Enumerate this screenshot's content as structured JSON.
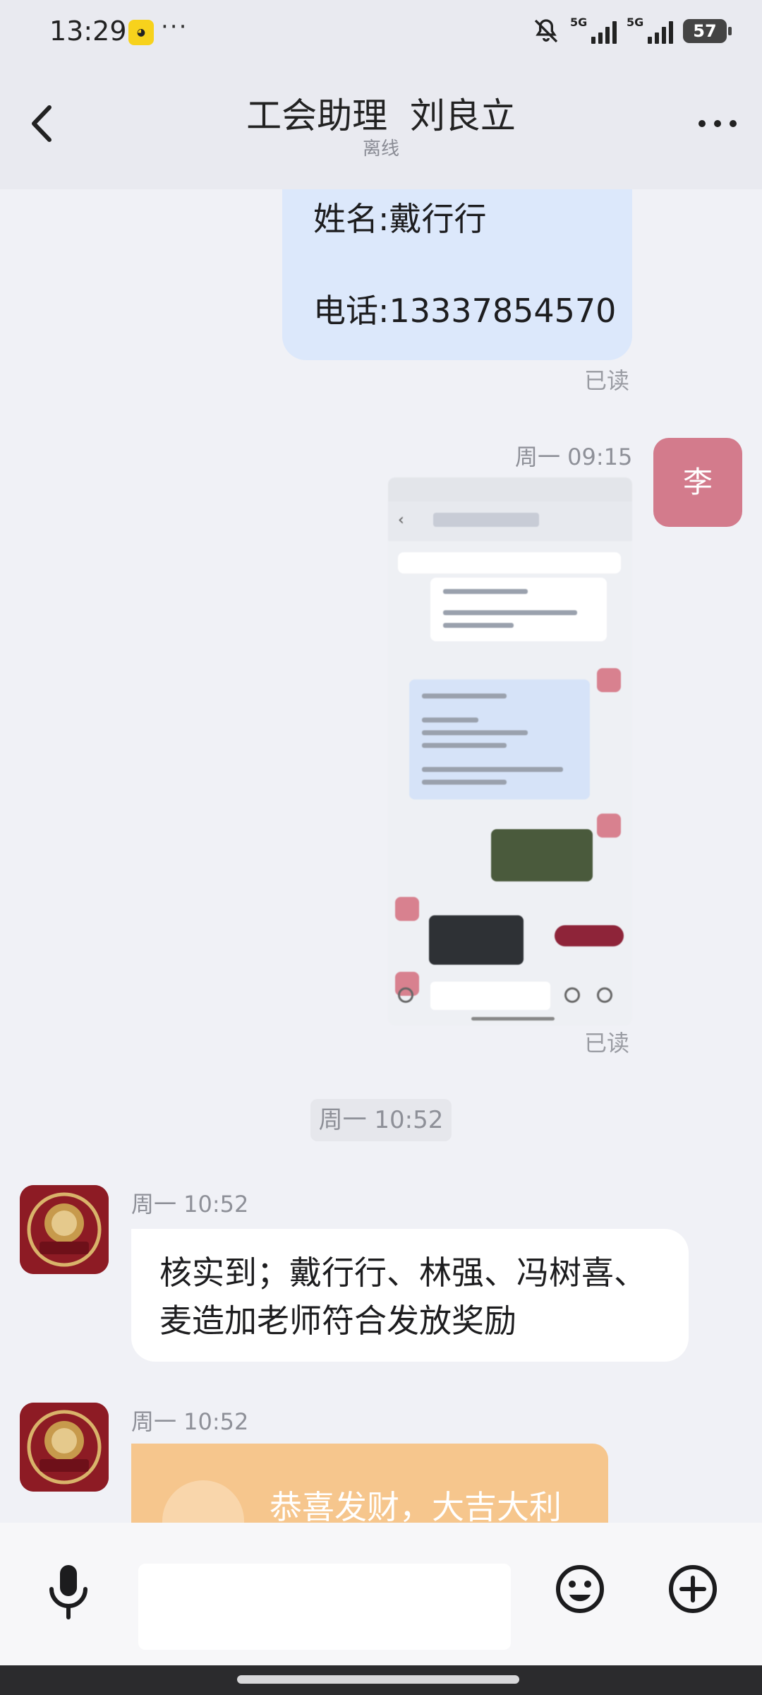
{
  "status_bar": {
    "time": "13:29",
    "dots": "···",
    "signal1_label": "5G",
    "signal2_label": "5G",
    "battery": "57"
  },
  "header": {
    "title": "工会助理  刘良立",
    "subtitle": "离线"
  },
  "messages": {
    "self_card": {
      "name_line": "姓名:戴行行",
      "phone_line": "电话:13337854570",
      "read_status": "已读"
    },
    "self_image": {
      "time": "周一 09:15",
      "avatar_text": "李",
      "read_status": "已读"
    },
    "time_divider": "周一 10:52",
    "other_text": {
      "time": "周一 10:52",
      "avatar_label": "领航工会",
      "text": "核实到；戴行行、林强、冯树喜、麦造加老师符合发放奖励"
    },
    "red_packet": {
      "time": "周一 10:52",
      "avatar_label": "领航工会",
      "text": "恭喜发财，大吉大利"
    }
  },
  "input_bar": {
    "placeholder": ""
  },
  "icons": {
    "back": "chevron-left-icon",
    "more": "more-horizontal-icon",
    "mic": "microphone-icon",
    "emoji": "emoji-icon",
    "plus": "plus-circle-icon",
    "mute": "bell-off-icon"
  },
  "colors": {
    "self_bubble": "#dce8fb",
    "avatar_li": "#d37b8c",
    "seal_red": "#8d1b24",
    "red_packet": "#f6c68d"
  }
}
